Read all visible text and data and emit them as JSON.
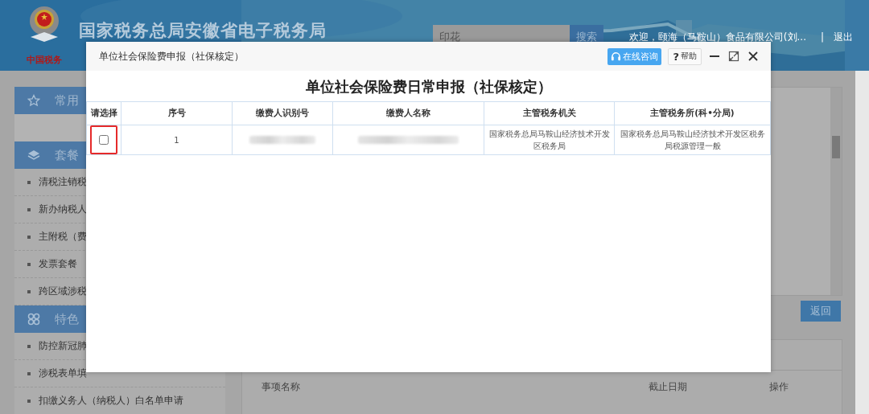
{
  "header": {
    "logo_text": "中国税务",
    "title": "国家税务总局安徽省电子税务局",
    "search": {
      "value": "印花"
    },
    "search_button": "搜索",
    "welcome": "欢迎，颐海（马鞍山）食品有限公司(刘...",
    "separator": "|",
    "logout": "退出"
  },
  "sidebar": {
    "sections": [
      {
        "kind": "star",
        "title": "常用"
      },
      {
        "kind": "layers",
        "title": "套餐",
        "items": [
          "清税注销税",
          "新办纳税人",
          "主附税（费",
          "发票套餐",
          "跨区域涉税"
        ]
      },
      {
        "kind": "clover",
        "title": "特色",
        "items": [
          "防控新冠肺",
          "涉税表单填",
          "扣缴义务人（纳税人）白名单申请"
        ]
      }
    ]
  },
  "main": {
    "return_button": "返回",
    "columns": [
      "事项名称",
      "截止日期",
      "操作"
    ]
  },
  "dialog": {
    "title": "单位社会保险费申报（社保核定）",
    "consult_button": "在线咨询",
    "help_button": "帮助",
    "help_mark": "?",
    "heading": "单位社会保险费日常申报（社保核定）",
    "columns": [
      "请选择",
      "序号",
      "缴费人识别号",
      "缴费人名称",
      "主管税务机关",
      "主管税务所(科•分局)"
    ],
    "rows": [
      {
        "cells": [
          {
            "kind": "checkbox",
            "checked": false,
            "highlighted": true
          },
          {
            "kind": "text",
            "text": "1"
          },
          {
            "kind": "redacted"
          },
          {
            "kind": "redacted"
          },
          {
            "kind": "text",
            "text": "国家税务总局马鞍山经济技术开发区税务局"
          },
          {
            "kind": "text",
            "text": "国家税务总局马鞍山经济技术开发区税务局税源管理一般"
          }
        ]
      }
    ]
  }
}
